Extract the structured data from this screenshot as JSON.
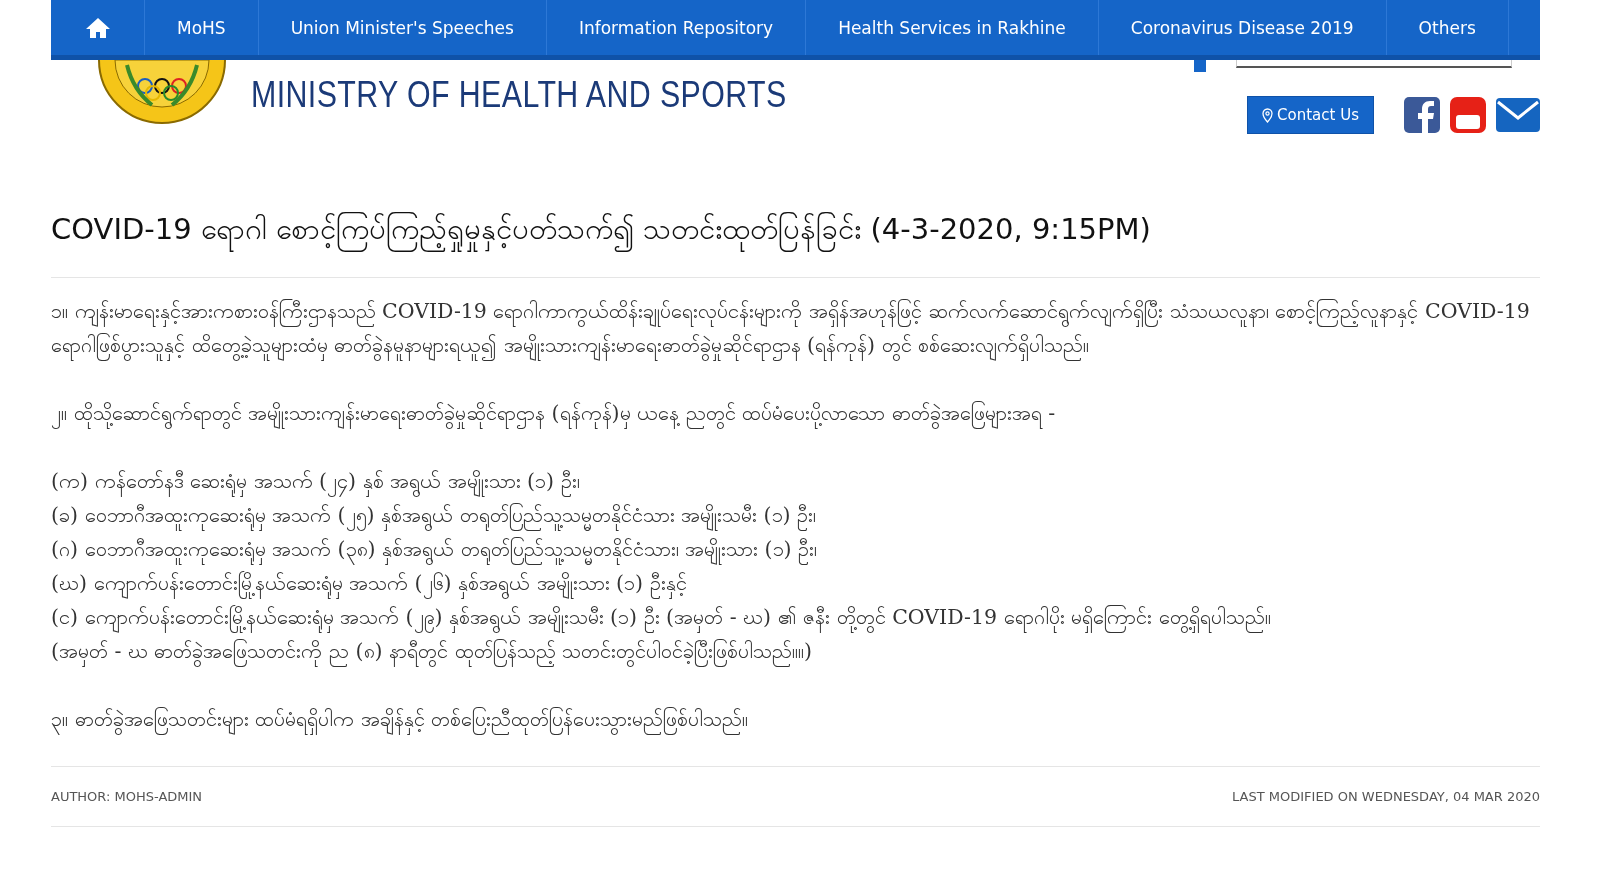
{
  "nav": {
    "items": [
      {
        "kind": "home"
      },
      {
        "kind": "link",
        "label": "MoHS"
      },
      {
        "kind": "link",
        "label": "Union Minister's Speeches"
      },
      {
        "kind": "link",
        "label": "Information Repository"
      },
      {
        "kind": "link",
        "label": "Health Services in Rakhine"
      },
      {
        "kind": "link",
        "label": "Coronavirus Disease 2019"
      },
      {
        "kind": "link",
        "label": "Others"
      }
    ]
  },
  "header": {
    "site_title": "MINISTRY OF HEALTH AND SPORTS",
    "contact_button": "Contact Us"
  },
  "article": {
    "title": "COVID-19 ရောဂါ စောင့်ကြပ်ကြည့်ရှုမှုနှင့်ပတ်သက်၍ သတင်းထုတ်ပြန်ခြင်း (4-3-2020, 9:15PM)",
    "blocks": [
      {
        "lines": [
          "၁။ ကျန်းမာရေးနှင့်အားကစားဝန်ကြီးဌာနသည် COVID-19 ရောဂါကာကွယ်ထိန်းချုပ်ရေးလုပ်ငန်းများကို အရှိန်အဟုန်ဖြင့် ဆက်လက်ဆောင်ရွက်လျက်ရှိပြီး သံသယလူနာ၊ စောင့်ကြည့်လူနာနှင့် COVID-19 ရောဂါဖြစ်ပွားသူနှင့် ထိတွေ့ခဲ့သူများထံမှ ဓာတ်ခွဲနမူနာများရယူ၍ အမျိုးသားကျန်းမာရေးဓာတ်ခွဲမှုဆိုင်ရာဌာန (ရန်ကုန်) တွင် စစ်ဆေးလျက်ရှိပါသည်။"
        ]
      },
      {
        "lines": [
          "၂။ ထိုသို့ဆောင်ရွက်ရာတွင် အမျိုးသားကျန်းမာရေးဓာတ်ခွဲမှုဆိုင်ရာဌာန (ရန်ကုန်)မှ ယနေ့ ညတွင် ထပ်မံပေးပို့လာသော ဓာတ်ခွဲအဖြေများအရ -"
        ]
      },
      {
        "lines": [
          "(က) ကန်တော်နဒီ ဆေးရုံမှ အသက် (၂၄) နှစ် အရွယ် အမျိုးသား (၁) ဦး၊",
          "(ခ) ဝေဘာဂီအထူးကုဆေးရုံမှ အသက် (၂၅) နှစ်အရွယ် တရုတ်ပြည်သူ့သမ္မတနိုင်ငံသား အမျိုးသမီး (၁) ဦး၊",
          "(ဂ) ဝေဘာဂီအထူးကုဆေးရုံမှ အသက် (၃၈) နှစ်အရွယ် တရုတ်ပြည်သူ့သမ္မတနိုင်ငံသား၊ အမျိုးသား (၁) ဦး၊",
          "(ဃ) ကျောက်ပန်းတောင်းမြို့နယ်ဆေးရုံမှ အသက် (၂၆) နှစ်အရွယ် အမျိုးသား (၁) ဦးနှင့်",
          "(င) ကျောက်ပန်းတောင်းမြို့နယ်ဆေးရုံမှ အသက် (၂၉) နှစ်အရွယ် အမျိုးသမီး (၁) ဦး (အမှတ် - ဃ) ၏ ဇနီး တို့တွင် COVID-19 ရောဂါပိုး မရှိကြောင်း တွေ့ရှိရပါသည်။",
          "(အမှတ် - ဃ ဓာတ်ခွဲအဖြေသတင်းကို ည (၈) နာရီတွင် ထုတ်ပြန်သည့် သတင်းတွင်ပါဝင်ခဲ့ပြီးဖြစ်ပါသည်။။)"
        ]
      },
      {
        "lines": [
          "၃။ ဓာတ်ခွဲအဖြေသတင်းများ ထပ်မံရရှိပါက အချိန်နှင့် တစ်ပြေးညီထုတ်ပြန်ပေးသွားမည်ဖြစ်ပါသည်။"
        ]
      }
    ],
    "author": "AUTHOR: MOHS-ADMIN",
    "modified": "LAST MODIFIED ON WEDNESDAY, 04 MAR 2020"
  }
}
